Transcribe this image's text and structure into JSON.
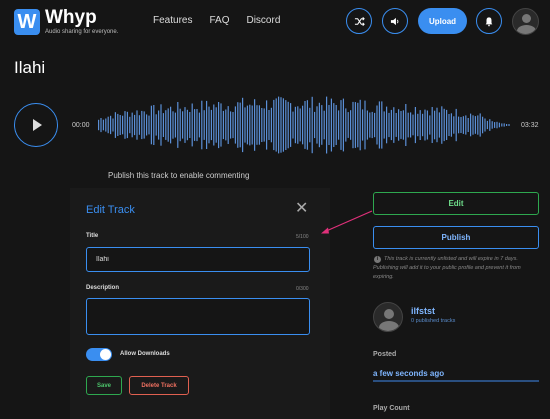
{
  "app": {
    "name": "Whyp",
    "logo_letter": "W",
    "tagline": "Audio sharing for everyone.",
    "accent_color": "#3a8ef0"
  },
  "nav": {
    "items": [
      "Features",
      "FAQ",
      "Discord"
    ]
  },
  "header_actions": {
    "shuffle_icon": "shuffle-icon",
    "volume_icon": "volume-icon",
    "upload_label": "Upload",
    "bell_icon": "bell-icon",
    "avatar_icon": "user-avatar-icon"
  },
  "track": {
    "title": "Ilahi",
    "time_current": "00:00",
    "time_total": "03:32",
    "commenting_notice": "Publish this track to enable commenting"
  },
  "edit_track": {
    "heading": "Edit Track",
    "title_label": "Title",
    "title_count": "5/100",
    "title_value": "Ilahi",
    "description_label": "Description",
    "description_count": "0/300",
    "description_value": "",
    "allow_downloads_label": "Allow Downloads",
    "allow_downloads": true,
    "save_label": "Save",
    "delete_label": "Delete Track"
  },
  "sidebar": {
    "edit_label": "Edit",
    "publish_label": "Publish",
    "info_text": "This track is currently unlisted and will expire in 7 days. Publishing will add it to your public profile and prevent it from expiring.",
    "user_name": "ilfstst",
    "user_tracks": "0 published tracks",
    "posted_label": "Posted",
    "posted_value": "a few seconds ago",
    "play_count_label": "Play Count"
  }
}
